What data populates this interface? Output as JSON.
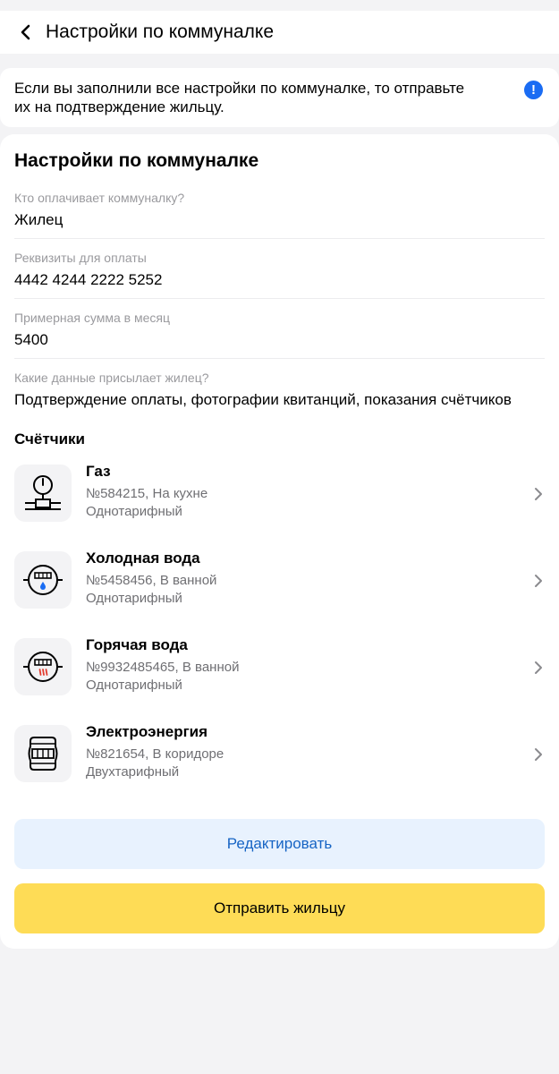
{
  "header": {
    "title": "Настройки по коммуналке"
  },
  "notice": {
    "text": "Если вы заполнили все настройки по коммуналке, то отправьте их на подтверждение жильцу.",
    "icon": "exclamation-icon",
    "icon_color": "#1a6cf3"
  },
  "card": {
    "title": "Настройки по коммуналке",
    "fields": [
      {
        "label": "Кто оплачивает коммуналку?",
        "value": "Жилец"
      },
      {
        "label": "Реквизиты для оплаты",
        "value": "4442 4244 2222 5252"
      },
      {
        "label": "Примерная сумма в месяц",
        "value": "5400"
      },
      {
        "label": "Какие данные присылает жилец?",
        "value": "Подтверждение оплаты, фотографии квитанций, показания счётчиков"
      }
    ],
    "meters_title": "Счётчики",
    "meters": [
      {
        "name": "Газ",
        "number_location": "№584215, На кухне",
        "tariff": "Однотарифный",
        "icon": "gas-meter-icon"
      },
      {
        "name": "Холодная вода",
        "number_location": "№5458456, В ванной",
        "tariff": "Однотарифный",
        "icon": "cold-water-meter-icon"
      },
      {
        "name": "Горячая вода",
        "number_location": "№9932485465, В ванной",
        "tariff": "Однотарифный",
        "icon": "hot-water-meter-icon"
      },
      {
        "name": "Электроэнергия",
        "number_location": "№821654, В коридоре",
        "tariff": "Двухтарифный",
        "icon": "electricity-meter-icon"
      }
    ]
  },
  "buttons": {
    "edit_label": "Редактировать",
    "send_label": "Отправить жильцу"
  },
  "colors": {
    "accent_blue": "#1664c4",
    "edit_bg": "#e8f2fe",
    "send_bg": "#fedc56",
    "water_drop": "#1a6cf3",
    "hot_marks": "#e23b2e"
  }
}
